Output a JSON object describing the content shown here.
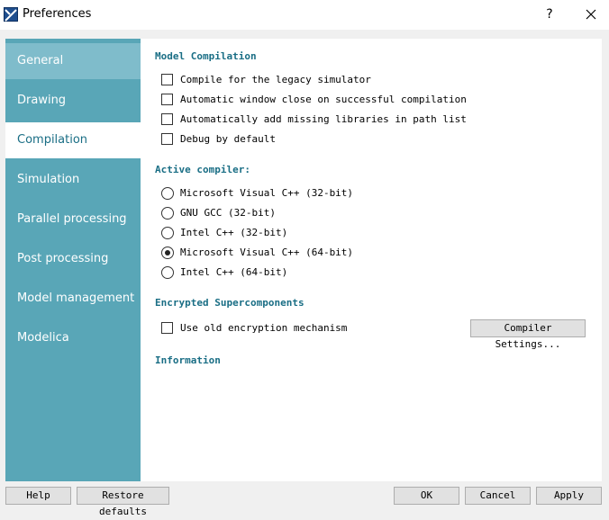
{
  "window": {
    "title": "Preferences",
    "help_label": "?"
  },
  "sidebar": {
    "items": [
      {
        "label": "General"
      },
      {
        "label": "Drawing"
      },
      {
        "label": "Compilation"
      },
      {
        "label": "Simulation"
      },
      {
        "label": "Parallel processing"
      },
      {
        "label": "Post processing"
      },
      {
        "label": "Model management"
      },
      {
        "label": "Modelica"
      }
    ],
    "active": "Compilation"
  },
  "model_compilation": {
    "heading": "Model Compilation",
    "options": [
      {
        "label": "Compile for the legacy simulator",
        "checked": false
      },
      {
        "label": "Automatic window close on successful compilation",
        "checked": false
      },
      {
        "label": "Automatically add missing libraries in path list",
        "checked": false
      },
      {
        "label": "Debug by default",
        "checked": false
      }
    ]
  },
  "active_compiler": {
    "heading": "Active compiler:",
    "options": [
      {
        "label": "Microsoft Visual C++ (32-bit)",
        "selected": false
      },
      {
        "label": "GNU GCC (32-bit)",
        "selected": false
      },
      {
        "label": "Intel C++ (32-bit)",
        "selected": false
      },
      {
        "label": "Microsoft Visual C++ (64-bit)",
        "selected": true
      },
      {
        "label": "Intel C++ (64-bit)",
        "selected": false
      }
    ]
  },
  "encrypted": {
    "heading": "Encrypted Supercomponents",
    "option": {
      "label": "Use old encryption mechanism",
      "checked": false
    },
    "settings_button": "Compiler Settings..."
  },
  "information": {
    "heading": "Information"
  },
  "footer": {
    "help": "Help",
    "restore": "Restore defaults",
    "ok": "OK",
    "cancel": "Cancel",
    "apply": "Apply"
  },
  "colors": {
    "sidebar": "#59a6b7",
    "sidebar_hover": "#7fbccb",
    "accent": "#1a6e85"
  }
}
